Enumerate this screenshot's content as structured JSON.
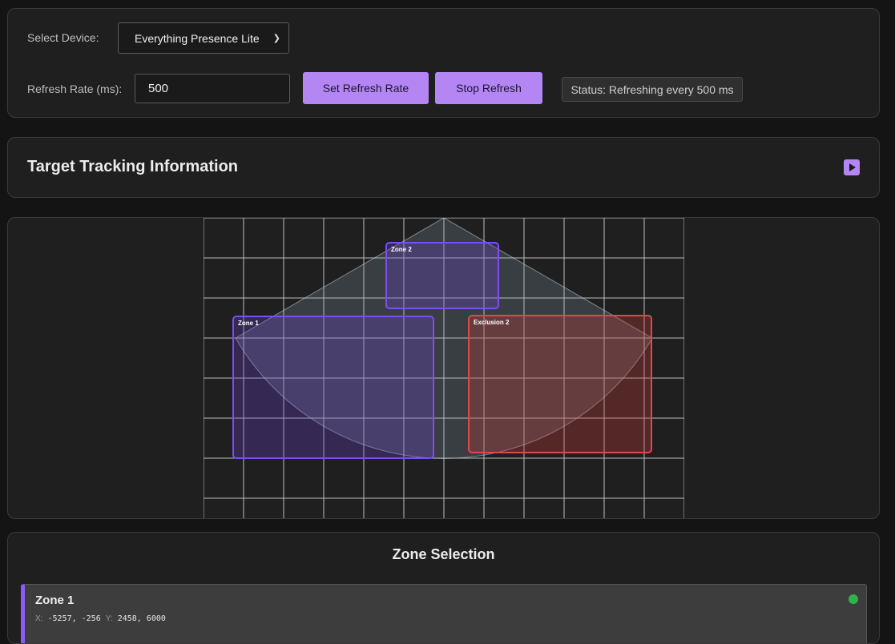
{
  "controls": {
    "device_label": "Select Device:",
    "device_selected": "Everything Presence Lite",
    "refresh_label": "Refresh Rate (ms):",
    "refresh_value": "500",
    "set_refresh_button": "Set Refresh Rate",
    "stop_refresh_button": "Stop Refresh",
    "status_text": "Status: Refreshing every 500 ms",
    "accent_color": "#b486f3"
  },
  "tracking": {
    "title": "Target Tracking Information",
    "expand_icon": "play-icon"
  },
  "radar": {
    "zones": [
      {
        "label": "Zone 1",
        "color": "#7c4df0"
      },
      {
        "label": "Zone 2",
        "color": "#7c4df0"
      },
      {
        "label": "Exclusion 2",
        "color": "#e04848"
      }
    ]
  },
  "zone_selection": {
    "title": "Zone Selection",
    "items": [
      {
        "name": "Zone 1",
        "x_key": "X:",
        "x_value": "-5257, -256",
        "y_key": "Y:",
        "y_value": "2458, 6000",
        "status_color": "#2db34a"
      }
    ]
  }
}
